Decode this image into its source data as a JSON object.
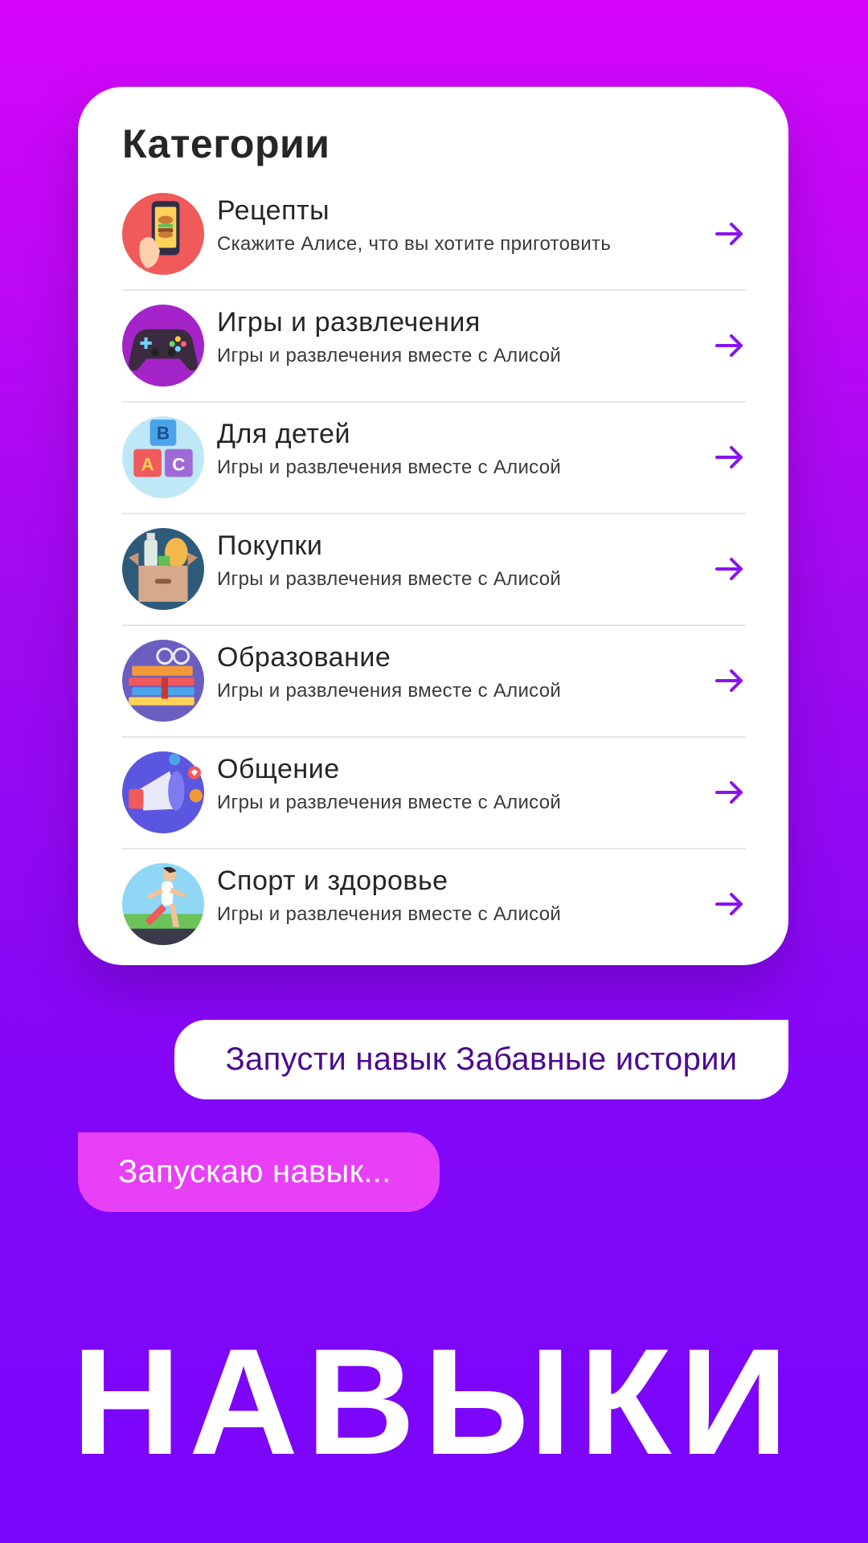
{
  "card": {
    "title": "Категории",
    "items": [
      {
        "title": "Рецепты",
        "subtitle": "Скажите Алисе, что вы хотите приготовить",
        "icon": "recipes-phone-icon"
      },
      {
        "title": "Игры и развлечения",
        "subtitle": "Игры и развлечения вместе с Алисой",
        "icon": "gamepad-icon"
      },
      {
        "title": "Для детей",
        "subtitle": "Игры и развлечения вместе с Алисой",
        "icon": "abc-blocks-icon"
      },
      {
        "title": "Покупки",
        "subtitle": "Игры и развлечения вместе с Алисой",
        "icon": "shopping-box-icon"
      },
      {
        "title": "Образование",
        "subtitle": "Игры и развлечения вместе с Алисой",
        "icon": "books-icon"
      },
      {
        "title": "Общение",
        "subtitle": "Игры и развлечения вместе с Алисой",
        "icon": "megaphone-icon"
      },
      {
        "title": "Спорт и здоровье",
        "subtitle": "Игры и развлечения вместе с Алисой",
        "icon": "runner-icon"
      }
    ]
  },
  "chat": {
    "user_message": "Запусти навык Забавные истории",
    "assistant_reply": "Запускаю навык..."
  },
  "headline": "НАВЫКИ",
  "colors": {
    "accent": "#8a12f0",
    "reply_bubble": "#e740f6",
    "user_text": "#4b0a8f"
  }
}
